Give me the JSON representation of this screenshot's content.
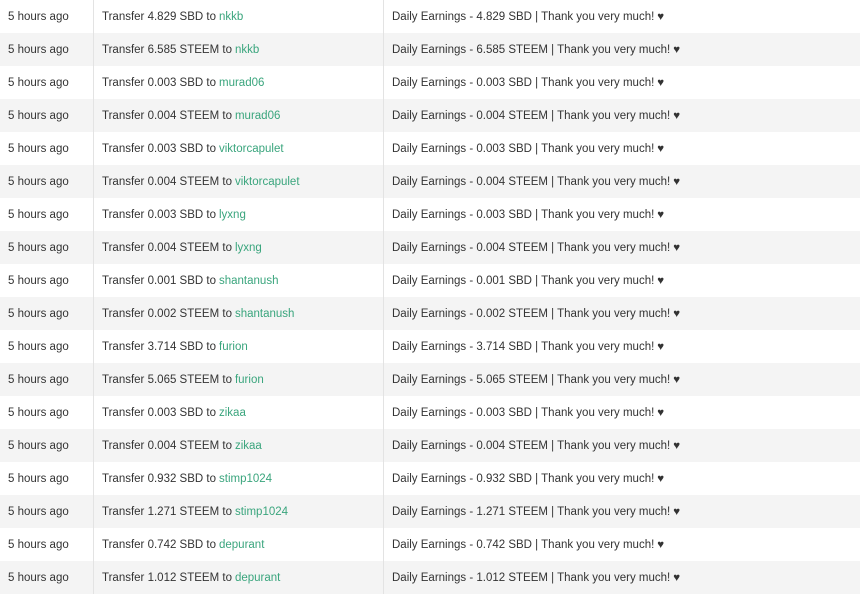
{
  "rows": [
    {
      "time": "5 hours ago",
      "prefix": "Transfer 4.829 SBD to",
      "account": "nkkb",
      "memo": "Daily Earnings - 4.829 SBD | Thank you very much!",
      "heart": "♥"
    },
    {
      "time": "5 hours ago",
      "prefix": "Transfer 6.585 STEEM to",
      "account": "nkkb",
      "memo": "Daily Earnings - 6.585 STEEM | Thank you very much!",
      "heart": "♥"
    },
    {
      "time": "5 hours ago",
      "prefix": "Transfer 0.003 SBD to",
      "account": "murad06",
      "memo": "Daily Earnings - 0.003 SBD | Thank you very much!",
      "heart": "♥"
    },
    {
      "time": "5 hours ago",
      "prefix": "Transfer 0.004 STEEM to",
      "account": "murad06",
      "memo": "Daily Earnings - 0.004 STEEM | Thank you very much!",
      "heart": "♥"
    },
    {
      "time": "5 hours ago",
      "prefix": "Transfer 0.003 SBD to",
      "account": "viktorcapulet",
      "memo": "Daily Earnings - 0.003 SBD | Thank you very much!",
      "heart": "♥"
    },
    {
      "time": "5 hours ago",
      "prefix": "Transfer 0.004 STEEM to",
      "account": "viktorcapulet",
      "memo": "Daily Earnings - 0.004 STEEM | Thank you very much!",
      "heart": "♥"
    },
    {
      "time": "5 hours ago",
      "prefix": "Transfer 0.003 SBD to",
      "account": "lyxng",
      "memo": "Daily Earnings - 0.003 SBD | Thank you very much!",
      "heart": "♥"
    },
    {
      "time": "5 hours ago",
      "prefix": "Transfer 0.004 STEEM to",
      "account": "lyxng",
      "memo": "Daily Earnings - 0.004 STEEM | Thank you very much!",
      "heart": "♥"
    },
    {
      "time": "5 hours ago",
      "prefix": "Transfer 0.001 SBD to",
      "account": "shantanush",
      "memo": "Daily Earnings - 0.001 SBD | Thank you very much!",
      "heart": "♥"
    },
    {
      "time": "5 hours ago",
      "prefix": "Transfer 0.002 STEEM to",
      "account": "shantanush",
      "memo": "Daily Earnings - 0.002 STEEM | Thank you very much!",
      "heart": "♥"
    },
    {
      "time": "5 hours ago",
      "prefix": "Transfer 3.714 SBD to",
      "account": "furion",
      "memo": "Daily Earnings - 3.714 SBD | Thank you very much!",
      "heart": "♥"
    },
    {
      "time": "5 hours ago",
      "prefix": "Transfer 5.065 STEEM to",
      "account": "furion",
      "memo": "Daily Earnings - 5.065 STEEM | Thank you very much!",
      "heart": "♥"
    },
    {
      "time": "5 hours ago",
      "prefix": "Transfer 0.003 SBD to",
      "account": "zikaa",
      "memo": "Daily Earnings - 0.003 SBD | Thank you very much!",
      "heart": "♥"
    },
    {
      "time": "5 hours ago",
      "prefix": "Transfer 0.004 STEEM to",
      "account": "zikaa",
      "memo": "Daily Earnings - 0.004 STEEM | Thank you very much!",
      "heart": "♥"
    },
    {
      "time": "5 hours ago",
      "prefix": "Transfer 0.932 SBD to",
      "account": "stimp1024",
      "memo": "Daily Earnings - 0.932 SBD | Thank you very much!",
      "heart": "♥"
    },
    {
      "time": "5 hours ago",
      "prefix": "Transfer 1.271 STEEM to",
      "account": "stimp1024",
      "memo": "Daily Earnings - 1.271 STEEM | Thank you very much!",
      "heart": "♥"
    },
    {
      "time": "5 hours ago",
      "prefix": "Transfer 0.742 SBD to",
      "account": "depurant",
      "memo": "Daily Earnings - 0.742 SBD | Thank you very much!",
      "heart": "♥"
    },
    {
      "time": "5 hours ago",
      "prefix": "Transfer 1.012 STEEM to",
      "account": "depurant",
      "memo": "Daily Earnings - 1.012 STEEM | Thank you very much!",
      "heart": "♥"
    }
  ]
}
